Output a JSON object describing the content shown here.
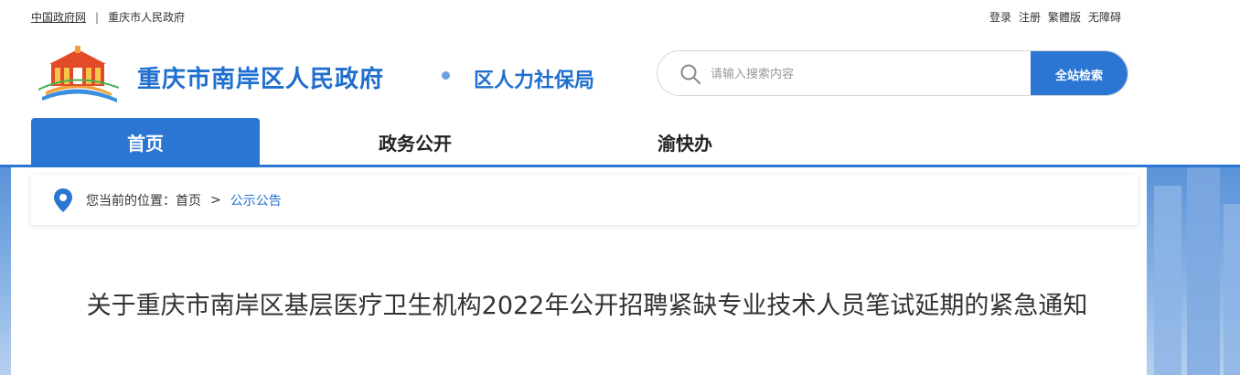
{
  "topbar": {
    "gov_link": "中国政府网",
    "separator": "|",
    "city_link": "重庆市人民政府",
    "login": "登录",
    "register": "注册",
    "traditional": "繁體版",
    "accessible": "无障碍"
  },
  "header": {
    "site_title": "重庆市南岸区人民政府",
    "dept_title": "区人力社保局"
  },
  "search": {
    "placeholder": "请输入搜索内容",
    "button_label": "全站检索"
  },
  "nav": {
    "items": [
      {
        "label": "首页",
        "active": true
      },
      {
        "label": "政务公开",
        "active": false
      },
      {
        "label": "渝快办",
        "active": false
      }
    ]
  },
  "breadcrumb": {
    "prefix": "您当前的位置：",
    "home": "首页",
    "gt": ">",
    "current": "公示公告"
  },
  "article": {
    "title": "关于重庆市南岸区基层医疗卫生机构2022年公开招聘紧缺专业技术人员笔试延期的紧急通知"
  },
  "colors": {
    "brand_blue": "#2b76d2",
    "title_blue": "#1f6fcf"
  }
}
